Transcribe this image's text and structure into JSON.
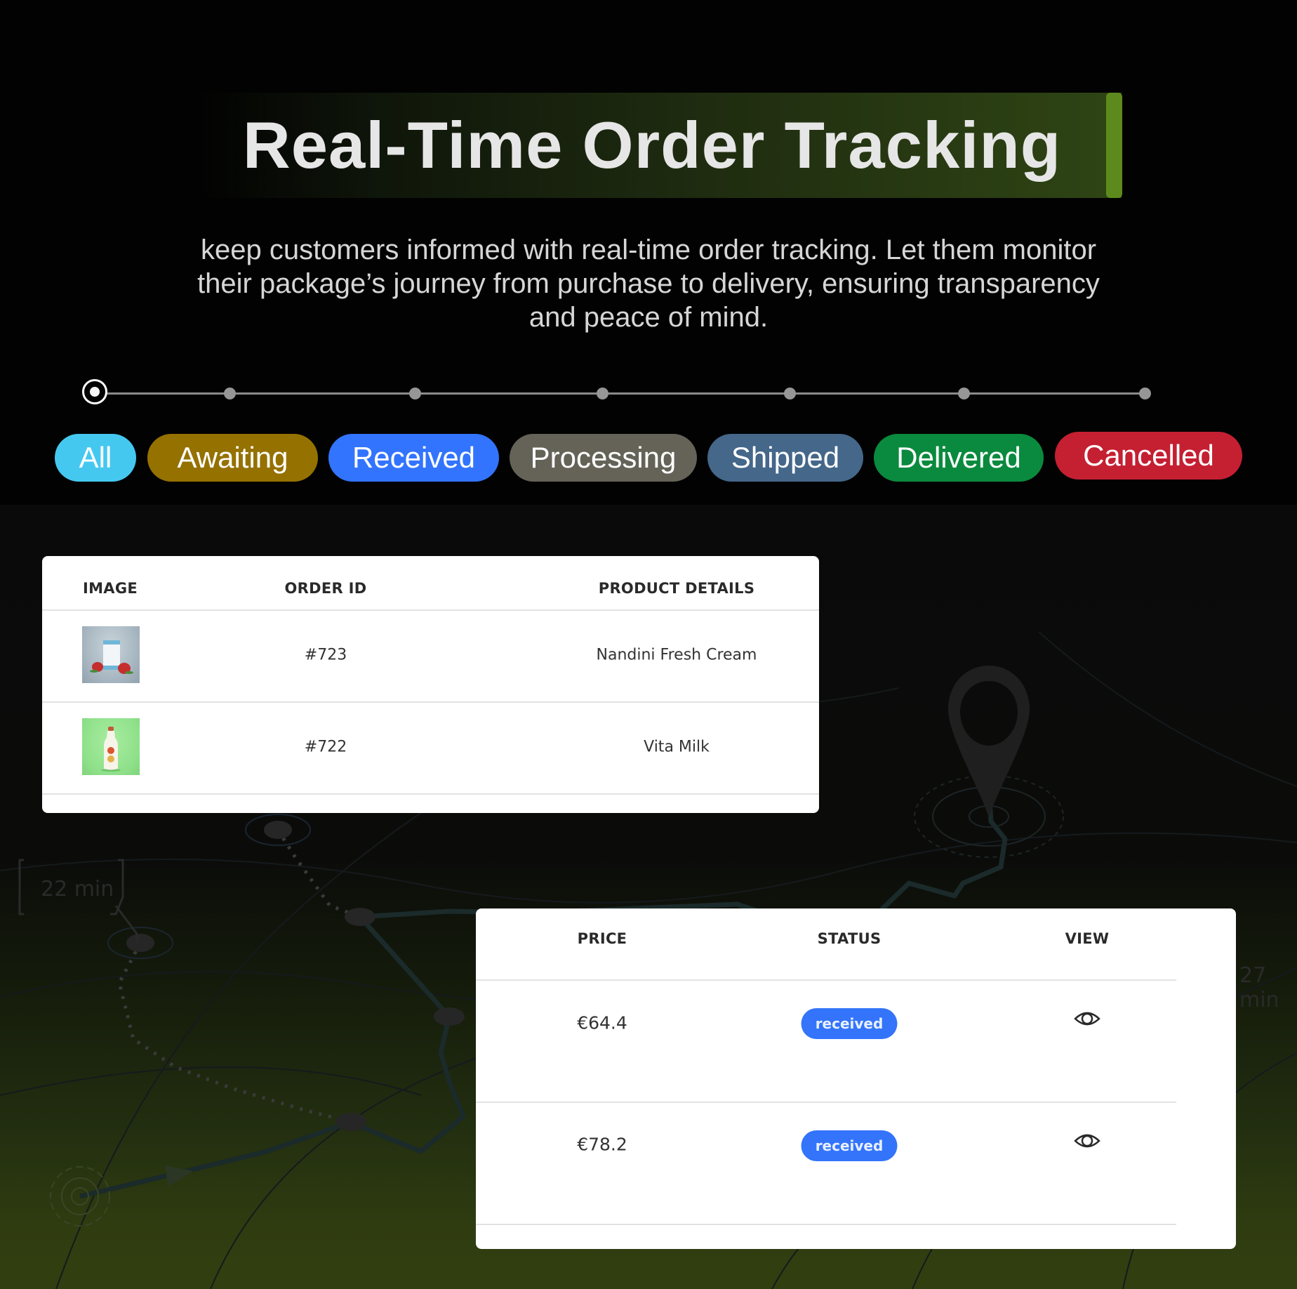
{
  "header": {
    "title": "Real-Time Order Tracking",
    "subtitle": "keep customers informed with real-time order tracking. Let them monitor their package’s journey from purchase to delivery, ensuring transparency and peace of mind."
  },
  "timeline": {
    "active_step": 1,
    "total_steps": 7
  },
  "filters": [
    {
      "label": "All",
      "color": "#45c8f0"
    },
    {
      "label": "Awaiting",
      "color": "#957100"
    },
    {
      "label": "Received",
      "color": "#3274fe"
    },
    {
      "label": "Processing",
      "color": "#656358"
    },
    {
      "label": "Shipped",
      "color": "#44678a"
    },
    {
      "label": "Delivered",
      "color": "#0a8a3e"
    },
    {
      "label": "Cancelled",
      "color": "#c51f32"
    }
  ],
  "orders_table": {
    "columns": [
      "IMAGE",
      "ORDER ID",
      "PRODUCT DETAILS"
    ],
    "rows": [
      {
        "image": "cream-pouch-thumbnail",
        "order_id": "#723",
        "product": "Nandini Fresh Cream"
      },
      {
        "image": "milk-bottle-thumbnail",
        "order_id": "#722",
        "product": "Vita Milk"
      }
    ]
  },
  "status_table": {
    "columns": [
      "PRICE",
      "STATUS",
      "VIEW"
    ],
    "rows": [
      {
        "price": "€64.4",
        "status": "received",
        "view_icon": "eye-icon"
      },
      {
        "price": "€78.2",
        "status": "received",
        "view_icon": "eye-icon"
      }
    ],
    "status_color": "#3374fb"
  },
  "map": {
    "labels": [
      "22 min",
      "27 min"
    ],
    "pin_icon": "location-pin-icon"
  },
  "colors": {
    "title_accent": "#5d8a1c",
    "background_top": "#020202",
    "background_bottom": "#313f10"
  }
}
